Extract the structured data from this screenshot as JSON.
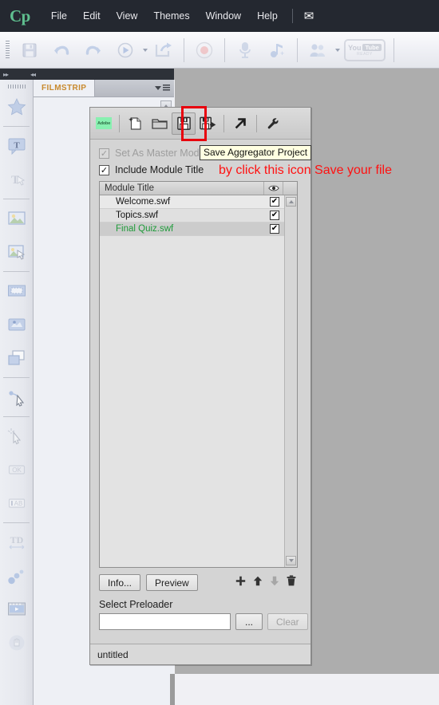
{
  "app": {
    "logo": "Cp",
    "menu_items": [
      {
        "label": "File"
      },
      {
        "label": "Edit"
      },
      {
        "label": "View"
      },
      {
        "label": "Themes"
      },
      {
        "label": "Window"
      },
      {
        "label": "Help"
      }
    ],
    "mail_icon": "✉"
  },
  "toolbar": {
    "items": [
      {
        "name": "save-icon",
        "label": "Save"
      },
      {
        "name": "undo-icon",
        "label": "Undo"
      },
      {
        "name": "redo-icon",
        "label": "Redo"
      },
      {
        "name": "preview-icon",
        "label": "Preview"
      },
      {
        "name": "publish-icon",
        "label": "Publish"
      },
      {
        "name": "record-icon",
        "label": "Record"
      },
      {
        "name": "microphone-icon",
        "label": "Record Audio"
      },
      {
        "name": "audio-note-icon",
        "label": "Add Audio"
      },
      {
        "name": "collaborate-icon",
        "label": "Collaborate"
      },
      {
        "name": "youtube-ready-icon",
        "label": "YouTube Ready"
      }
    ],
    "youtube": {
      "you": "You",
      "tube": "Tube",
      "ready": "READY"
    }
  },
  "filmstrip": {
    "tab_label": "FILMSTRIP"
  },
  "dialog": {
    "toolbar_buttons": [
      {
        "name": "adobe-logo-icon",
        "label": "Adobe"
      },
      {
        "name": "new-project-icon",
        "label": "New Aggregator Project"
      },
      {
        "name": "open-project-icon",
        "label": "Open Aggregator Project"
      },
      {
        "name": "save-project-icon",
        "label": "Save Aggregator Project"
      },
      {
        "name": "save-as-project-icon",
        "label": "Save As"
      },
      {
        "name": "publish-project-icon",
        "label": "Publish"
      },
      {
        "name": "settings-wrench-icon",
        "label": "Settings"
      }
    ],
    "adobe_logo_text": "Adobe",
    "checkboxes": [
      {
        "label": "Set As Master Module",
        "checked": true,
        "enabled": false,
        "mark": "✓"
      },
      {
        "label": "Include Module Title",
        "checked": true,
        "enabled": true,
        "mark": "✓"
      }
    ],
    "list": {
      "column_title": "Module Title",
      "column_eye_icon": "eye-icon",
      "rows": [
        {
          "title": "Welcome.swf",
          "visible": true,
          "mark": "✔",
          "highlighted": false
        },
        {
          "title": "Topics.swf",
          "visible": true,
          "mark": "✔",
          "highlighted": false
        },
        {
          "title": "Final Quiz.swf",
          "visible": true,
          "mark": "✔",
          "highlighted": true
        }
      ]
    },
    "actions": {
      "info_label": "Info...",
      "preview_label": "Preview",
      "add_icon": "add-icon",
      "move_up_icon": "move-up-icon",
      "move_down_icon": "move-down-icon",
      "delete_icon": "trash-icon"
    },
    "preloader": {
      "label": "Select Preloader",
      "value": "",
      "browse_label": "...",
      "clear_label": "Clear"
    },
    "status": "untitled"
  },
  "tooltip": {
    "text": "Save Aggregator Project"
  },
  "annotation": {
    "text": "by click this icon Save your file",
    "color": "#ff1111"
  },
  "highlight": {
    "color": "#e8000d",
    "target": "save-project-icon"
  },
  "left_rail": {
    "items": [
      {
        "name": "star-icon",
        "enabled": true
      },
      {
        "name": "text-caption-icon",
        "enabled": true
      },
      {
        "name": "rollover-caption-icon",
        "enabled": false
      },
      {
        "name": "image-icon",
        "enabled": true
      },
      {
        "name": "rollover-image-icon",
        "enabled": true
      },
      {
        "name": "highlight-box-icon",
        "enabled": true
      },
      {
        "name": "rollover-slidelet-icon",
        "enabled": true
      },
      {
        "name": "zoom-area-icon",
        "enabled": true
      },
      {
        "name": "mouse-path-icon",
        "enabled": true
      },
      {
        "name": "click-box-icon",
        "enabled": false
      },
      {
        "name": "ok-button-icon",
        "enabled": false
      },
      {
        "name": "text-entry-box-icon",
        "enabled": false
      },
      {
        "name": "text-animation-icon",
        "enabled": false
      },
      {
        "name": "animation-icon",
        "enabled": true
      },
      {
        "name": "video-icon",
        "enabled": true
      },
      {
        "name": "interaction-icon",
        "enabled": false
      }
    ]
  }
}
